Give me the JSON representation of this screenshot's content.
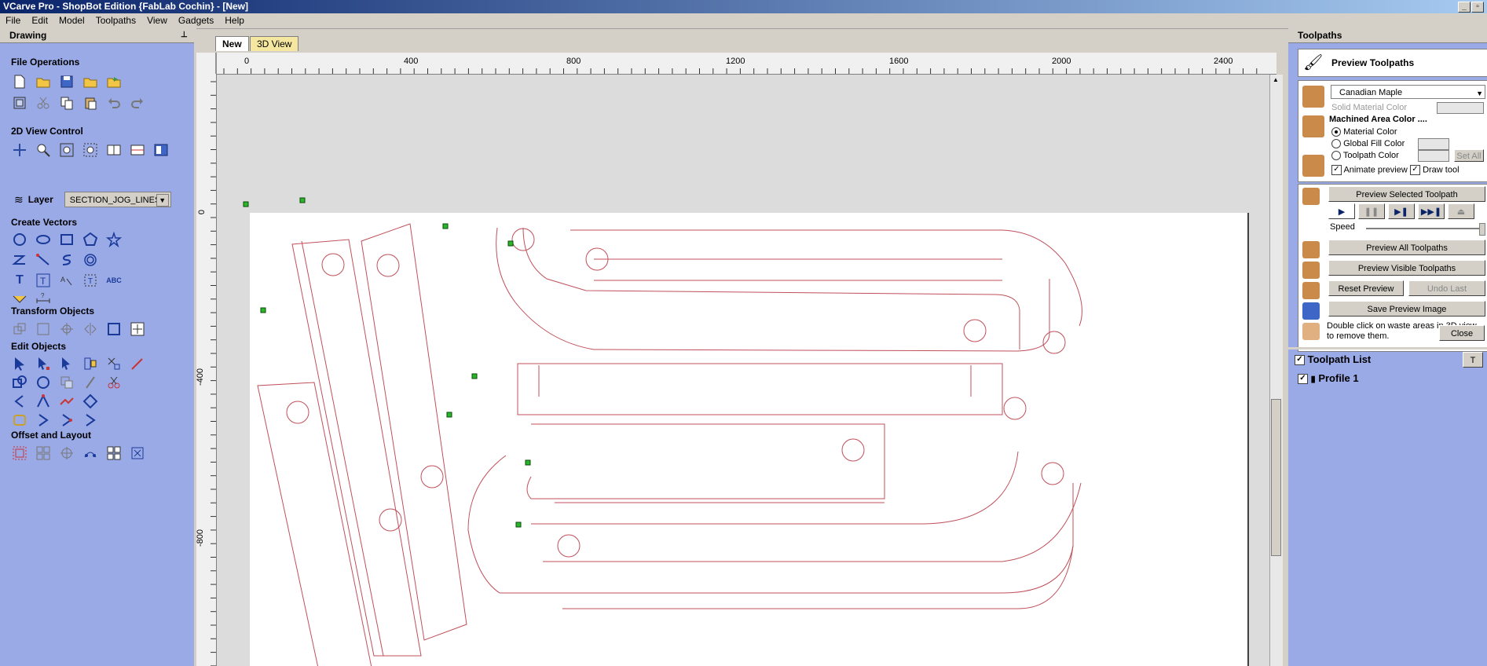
{
  "window": {
    "title": "VCarve Pro - ShopBot Edition {FabLab Cochin} - [New]"
  },
  "menu": [
    "File",
    "Edit",
    "Model",
    "Toolpaths",
    "View",
    "Gadgets",
    "Help"
  ],
  "left_panel": {
    "title": "Drawing",
    "sections": {
      "file_ops": "File Operations",
      "view_control": "2D View Control",
      "create_vectors": "Create Vectors",
      "transform": "Transform Objects",
      "edit": "Edit Objects",
      "offset": "Offset and Layout"
    },
    "layer_label": "Layer",
    "layer_value": "SECTION_JOG_LINES"
  },
  "tabs": [
    "New",
    "3D View"
  ],
  "ruler_top": [
    "0",
    "400",
    "800",
    "1200",
    "1600",
    "2000",
    "2400"
  ],
  "ruler_left": [
    "0",
    "-400",
    "-800"
  ],
  "right_panel": {
    "title": "Toolpaths",
    "preview_title": "Preview Toolpaths",
    "material": "Canadian Maple",
    "solid_material_color": "Solid Material Color",
    "machined_area_color": "Machined Area Color ....",
    "radio": {
      "material": "Material Color",
      "global": "Global Fill Color",
      "toolpath": "Toolpath Color"
    },
    "set_all": "Set All",
    "animate_preview": "Animate preview",
    "draw_tool": "Draw tool",
    "preview_selected": "Preview Selected Toolpath",
    "speed": "Speed",
    "preview_all": "Preview All Toolpaths",
    "preview_visible": "Preview Visible Toolpaths",
    "reset_preview": "Reset Preview",
    "undo_last": "Undo Last",
    "save_preview": "Save Preview Image",
    "hint": "Double click on waste areas in 3D view to remove them.",
    "close": "Close",
    "toolpath_list": "Toolpath List",
    "toolpaths": [
      "Profile 1"
    ]
  }
}
